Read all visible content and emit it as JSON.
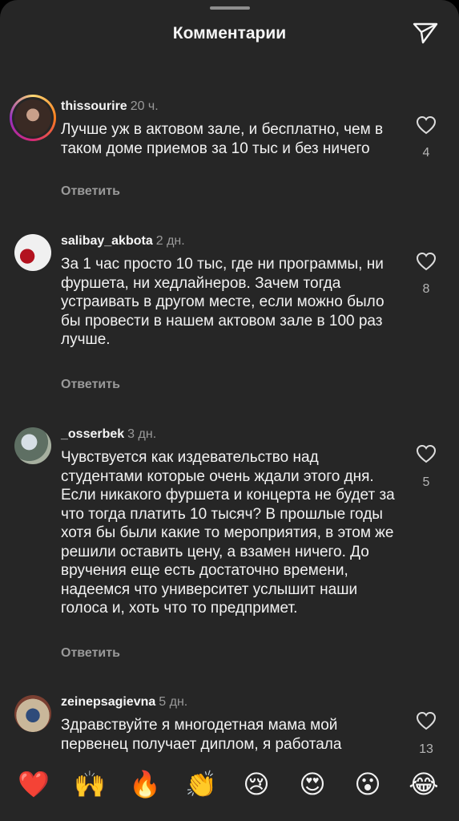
{
  "header": {
    "title": "Комментарии",
    "share_icon": "paper-plane-icon"
  },
  "comments": [
    {
      "username": "thissourire",
      "time": "20 ч.",
      "text": "Лучше уж в актовом зале, и бесплатно, чем в таком доме приемов за 10 тыс и без ничего",
      "reply": "Ответить",
      "likes": "4",
      "has_story": true
    },
    {
      "username": "salibay_akbota",
      "time": "2 дн.",
      "text": "За 1 час просто 10 тыс, где ни программы, ни фуршета, ни хедлайнеров. Зачем тогда устраивать в другом месте, если можно было бы провести в нашем актовом зале в 100 раз лучше.",
      "reply": "Ответить",
      "likes": "8"
    },
    {
      "username": "_osserbek",
      "time": "3 дн.",
      "text": "Чувствуется как издевательство над студентами которые очень ждали этого дня. Если никакого фуршета и концерта не будет за что тогда платить 10 тысяч? В прошлые годы хотя бы были какие то мероприятия, в этом же решили оставить цену, а взамен ничего. До вручения еще есть достаточно времени, надеемся что университет услышит наши голоса и, хоть что то предпримет.",
      "reply": "Ответить",
      "likes": "5"
    },
    {
      "username": "zeinepsagievna",
      "time": "5 дн.",
      "text": "Здравствуйте я многодетная мама мой первенец получает диплом, я работала",
      "likes": "13"
    }
  ],
  "emoji_bar": [
    "❤️",
    "🙌",
    "🔥",
    "👏",
    "😢",
    "😍",
    "😮",
    "😂"
  ],
  "colors": {
    "background": "#262626",
    "text": "#f2f2f2",
    "muted": "#9a9a9a"
  }
}
